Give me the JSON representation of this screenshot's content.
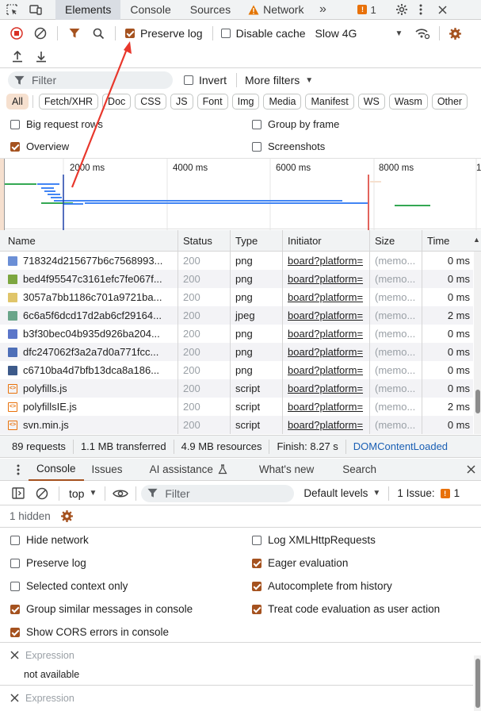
{
  "tabs": [
    "Elements",
    "Console",
    "Sources",
    "Network"
  ],
  "active_tab": "Elements",
  "issues_count": "1",
  "toolbar": {
    "preserve_log": "Preserve log",
    "disable_cache": "Disable cache",
    "throttle": "Slow 4G"
  },
  "filter": {
    "placeholder": "Filter",
    "invert": "Invert",
    "more_filters": "More filters"
  },
  "type_filters": [
    "All",
    "Fetch/XHR",
    "Doc",
    "CSS",
    "JS",
    "Font",
    "Img",
    "Media",
    "Manifest",
    "WS",
    "Wasm",
    "Other"
  ],
  "options": {
    "big_rows": "Big request rows",
    "group_by_frame": "Group by frame",
    "overview": "Overview",
    "screenshots": "Screenshots"
  },
  "timeline_ticks": [
    "2000 ms",
    "4000 ms",
    "6000 ms",
    "8000 ms",
    "1"
  ],
  "columns": [
    "Name",
    "Status",
    "Type",
    "Initiator",
    "Size",
    "Time"
  ],
  "rows": [
    {
      "name": "718324d215677b6c7568993...",
      "status": "200",
      "type": "png",
      "initiator": "board?platform=",
      "size": "(memo...",
      "time": "0 ms",
      "icon": "image-icon",
      "color": "#6b8fd6"
    },
    {
      "name": "bed4f95547c3161efc7fe067f...",
      "status": "200",
      "type": "png",
      "initiator": "board?platform=",
      "size": "(memo...",
      "time": "0 ms",
      "icon": "image-icon",
      "color": "#7da640"
    },
    {
      "name": "3057a7bb1186c701a9721ba...",
      "status": "200",
      "type": "png",
      "initiator": "board?platform=",
      "size": "(memo...",
      "time": "0 ms",
      "icon": "image-icon",
      "color": "#e0c56a"
    },
    {
      "name": "6c6a5f6dcd17d2ab6cf29164...",
      "status": "200",
      "type": "jpeg",
      "initiator": "board?platform=",
      "size": "(memo...",
      "time": "2 ms",
      "icon": "image-icon",
      "color": "#6aa58a"
    },
    {
      "name": "b3f30bec04b935d926ba204...",
      "status": "200",
      "type": "png",
      "initiator": "board?platform=",
      "size": "(memo...",
      "time": "0 ms",
      "icon": "image-icon",
      "color": "#5b76c9"
    },
    {
      "name": "dfc247062f3a2a7d0a771fcc...",
      "status": "200",
      "type": "png",
      "initiator": "board?platform=",
      "size": "(memo...",
      "time": "0 ms",
      "icon": "image-icon",
      "color": "#4e6fb8"
    },
    {
      "name": "c6710ba4d7bfb13dca8a186...",
      "status": "200",
      "type": "png",
      "initiator": "board?platform=",
      "size": "(memo...",
      "time": "0 ms",
      "icon": "image-icon",
      "color": "#3d5a8a"
    },
    {
      "name": "polyfills.js",
      "status": "200",
      "type": "script",
      "initiator": "board?platform=",
      "size": "(memo...",
      "time": "0 ms",
      "icon": "script-icon",
      "color": "#e8710a"
    },
    {
      "name": "polyfillsIE.js",
      "status": "200",
      "type": "script",
      "initiator": "board?platform=",
      "size": "(memo...",
      "time": "2 ms",
      "icon": "script-icon",
      "color": "#e8710a"
    },
    {
      "name": "svn.min.js",
      "status": "200",
      "type": "script",
      "initiator": "board?platform=",
      "size": "(memo...",
      "time": "0 ms",
      "icon": "script-icon",
      "color": "#e8710a"
    }
  ],
  "status_bar": {
    "requests": "89 requests",
    "transferred": "1.1 MB transferred",
    "resources": "4.9 MB resources",
    "finish": "Finish: 8.27 s",
    "dcl": "DOMContentLoaded"
  },
  "drawer_tabs": [
    "Console",
    "Issues",
    "AI assistance",
    "What's new",
    "Search"
  ],
  "console_toolbar": {
    "context": "top",
    "filter_placeholder": "Filter",
    "levels": "Default levels",
    "issue_label": "1 Issue:",
    "issue_count": "1"
  },
  "hidden_count": "1 hidden",
  "console_options": {
    "left": [
      {
        "label": "Hide network",
        "checked": false
      },
      {
        "label": "Preserve log",
        "checked": false
      },
      {
        "label": "Selected context only",
        "checked": false
      },
      {
        "label": "Group similar messages in console",
        "checked": true
      },
      {
        "label": "Show CORS errors in console",
        "checked": true
      }
    ],
    "right": [
      {
        "label": "Log XMLHttpRequests",
        "checked": false
      },
      {
        "label": "Eager evaluation",
        "checked": true
      },
      {
        "label": "Autocomplete from history",
        "checked": true
      },
      {
        "label": "Treat code evaluation as user action",
        "checked": true
      }
    ]
  },
  "expressions": [
    {
      "label": "Expression",
      "value": "not available"
    },
    {
      "label": "Expression",
      "value": ""
    }
  ],
  "colors": {
    "accent": "#a5521f",
    "annotation": "#e8372c",
    "error": "#e8372c"
  }
}
